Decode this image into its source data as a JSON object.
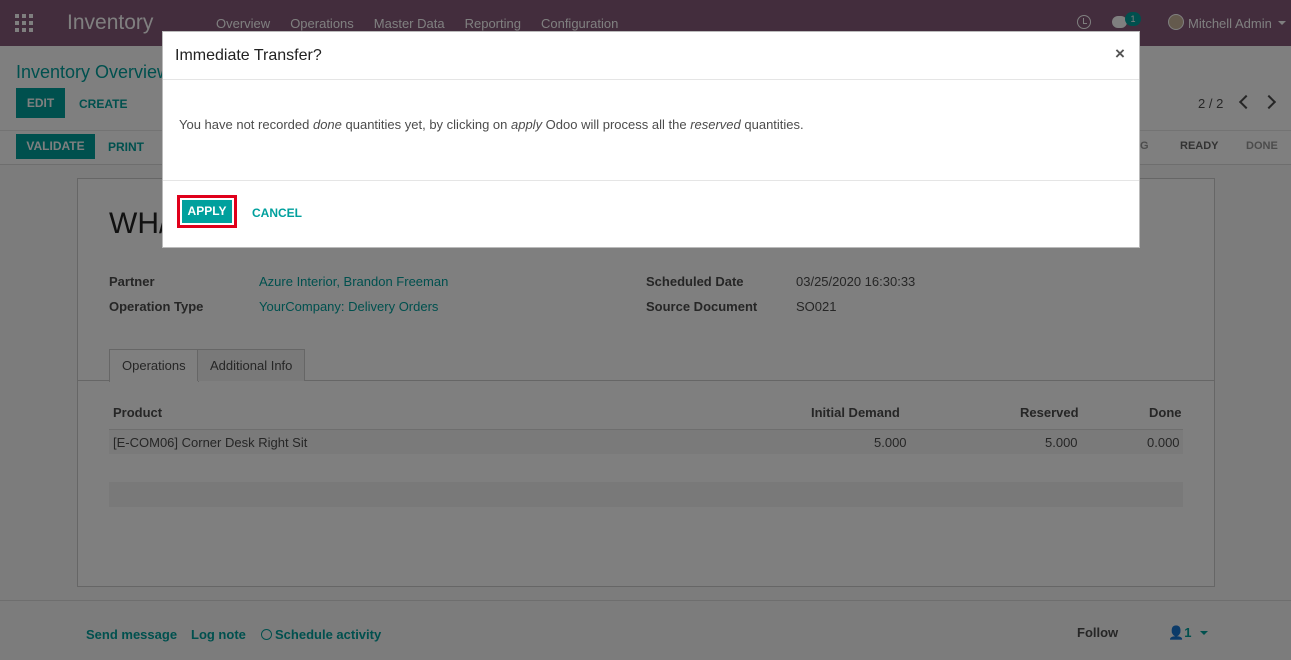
{
  "navbar": {
    "app_name": "Inventory",
    "menu": [
      "Overview",
      "Operations",
      "Master Data",
      "Reporting",
      "Configuration"
    ],
    "chat_count": "1",
    "user_name": "Mitchell Admin",
    "bg_color": "#875a7b"
  },
  "control_panel": {
    "breadcrumb": "Inventory Overview",
    "edit_label": "EDIT",
    "create_label": "CREATE",
    "pager": "2 / 2",
    "validate_label": "VALIDATE",
    "print_label": "PRINT",
    "statuses": [
      "G",
      "READY",
      "DONE"
    ],
    "active_status": "READY"
  },
  "form": {
    "title": "WH/",
    "partner_label": "Partner",
    "partner_value": "Azure Interior, Brandon Freeman",
    "operation_type_label": "Operation Type",
    "operation_type_value": "YourCompany: Delivery Orders",
    "scheduled_date_label": "Scheduled Date",
    "scheduled_date_value": "03/25/2020 16:30:33",
    "source_document_label": "Source Document",
    "source_document_value": "SO021",
    "tabs": [
      "Operations",
      "Additional Info"
    ],
    "table": {
      "headers": [
        "Product",
        "Initial Demand",
        "Reserved",
        "Done"
      ],
      "rows": [
        [
          "[E-COM06] Corner Desk Right Sit",
          "5.000",
          "5.000",
          "0.000"
        ]
      ]
    }
  },
  "chatter": {
    "send_message": "Send message",
    "log_note": "Log note",
    "schedule_activity": "Schedule activity",
    "follow": "Follow",
    "followers_count": "1"
  },
  "modal": {
    "title": "Immediate Transfer?",
    "close": "×",
    "body": {
      "part1": "You have not recorded ",
      "em1": "done",
      "part2": " quantities yet, by clicking on ",
      "em2": "apply",
      "part3": " Odoo will process all the ",
      "em3": "reserved",
      "part4": " quantities."
    },
    "apply_label": "APPLY",
    "cancel_label": "CANCEL",
    "accent_color": "#00a09d",
    "highlight_color": "#e0001b"
  }
}
